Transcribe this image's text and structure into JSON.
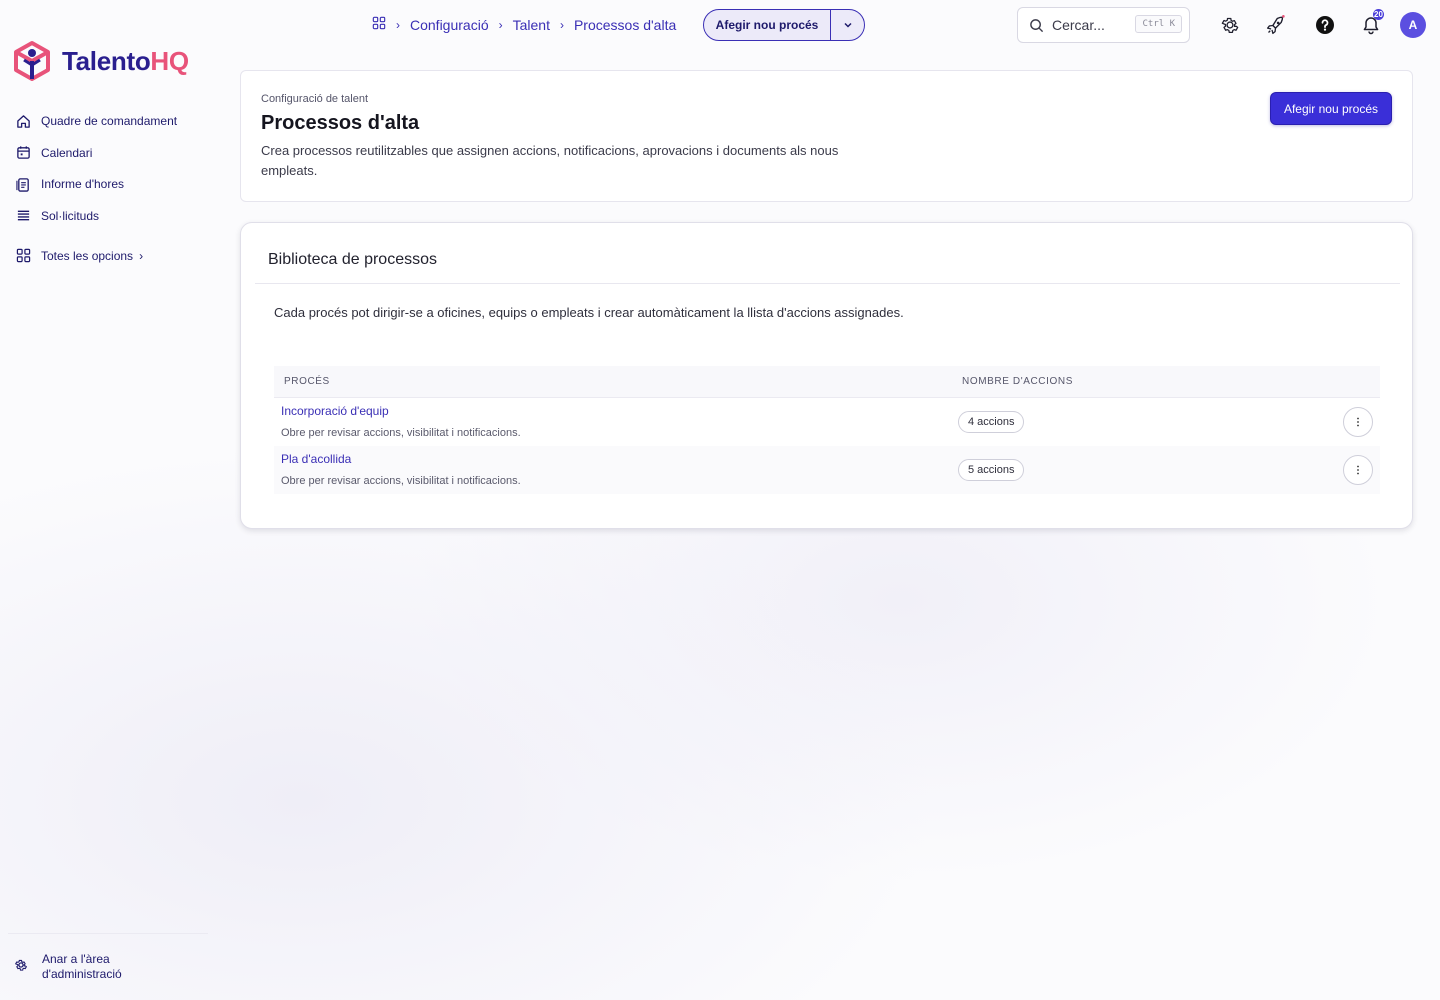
{
  "brand": {
    "name_part1": "Talento",
    "name_part2": "HQ"
  },
  "sidebar": {
    "items": [
      {
        "label": "Quadre de comandament",
        "icon": "home-icon"
      },
      {
        "label": "Calendari",
        "icon": "calendar-icon"
      },
      {
        "label": "Informe d'hores",
        "icon": "timesheet-icon"
      },
      {
        "label": "Sol·licituds",
        "icon": "list-icon"
      }
    ],
    "all_options": "Totes les opcions",
    "admin_line1": "Anar a l'àrea",
    "admin_line2": "d'administració"
  },
  "topbar": {
    "breadcrumbs": [
      "Configuració",
      "Talent",
      "Processos d'alta"
    ],
    "split_button_label": "Afegir nou procés",
    "search_placeholder": "Cercar...",
    "search_shortcut": "Ctrl K",
    "notification_count": "20",
    "avatar_initial": "A"
  },
  "header": {
    "eyebrow": "Configuració de talent",
    "title": "Processos d'alta",
    "description": "Crea processos reutilitzables que assignen accions, notificacions, aprovacions i documents als nous empleats.",
    "primary_button": "Afegir nou procés"
  },
  "library": {
    "title": "Biblioteca de processos",
    "description": "Cada procés pot dirigir-se a oficines, equips o empleats i crear automàticament la llista d'accions assignades.",
    "columns": [
      "PROCÉS",
      "NOMBRE D'ACCIONS"
    ],
    "rows": [
      {
        "name": "Incorporació d'equip",
        "subtitle": "Obre per revisar accions, visibilitat i notificacions.",
        "actions": "4 accions"
      },
      {
        "name": "Pla d'acollida",
        "subtitle": "Obre per revisar accions, visibilitat i notificacions.",
        "actions": "5 accions"
      }
    ]
  },
  "colors": {
    "accent": "#3a2fd8",
    "brand_dark": "#2a1f8f",
    "brand_pink": "#e8537a"
  }
}
